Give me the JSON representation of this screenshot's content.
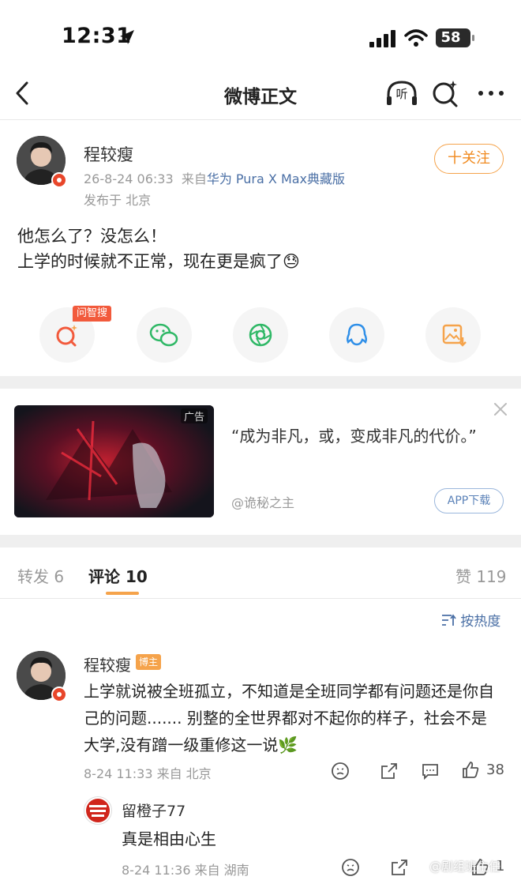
{
  "status_bar": {
    "time": "12:31",
    "battery": "58"
  },
  "nav": {
    "title": "微博正文",
    "listen_label": "听"
  },
  "post": {
    "author": "程较瘦",
    "timestamp": "26-8-24 06:33",
    "source_prefix": "来自",
    "source": "华为 Pura X Max典藏版",
    "location": "发布于 北京",
    "follow_label": "十关注",
    "text_line1": "他怎么了？没怎么！",
    "text_line2": "上学的时候就不正常，现在更是疯了😓"
  },
  "share": {
    "ask_tag": "问智搜",
    "icons": [
      "ai-search-icon",
      "wechat-icon",
      "moments-icon",
      "qq-icon",
      "save-image-icon"
    ]
  },
  "ad": {
    "label": "广告",
    "text": "“成为非凡，或，变成非凡的代价。”",
    "author": "@诡秘之主",
    "button": "APP下载"
  },
  "tabs": {
    "repost": "转发 6",
    "comments": "评论 10",
    "likes": "赞 119"
  },
  "sort_label": "按热度",
  "comments": [
    {
      "author": "程较瘦",
      "tag": "博主",
      "text": "上学就说被全班孤立，不知道是全班同学都有问题还是你自己的问题....... 别整的全世界都对不起你的样子，社会不是大学,没有蹭一级重修这一说🌿",
      "meta": "8-24 11:33  来自 北京",
      "likes": "38"
    },
    {
      "author": "留橙子77",
      "text": "真是相由心生",
      "meta": "8-24 11:36  来自 湖南",
      "likes": "1"
    }
  ],
  "watermark": "@剧组班主任",
  "colors": {
    "accent": "#f5a34b",
    "link": "#4a6fa5",
    "badge_red": "#e8462a"
  }
}
